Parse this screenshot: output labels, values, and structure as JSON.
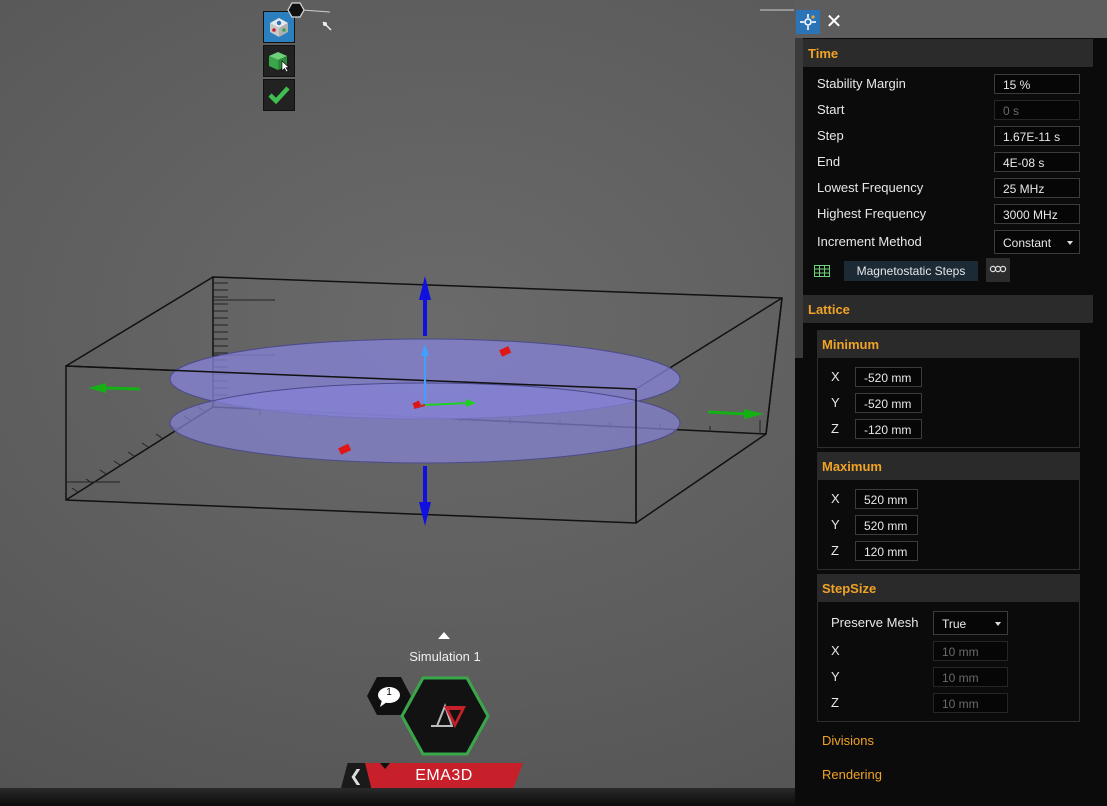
{
  "simulation": {
    "name": "Simulation 1",
    "notification_count": "1"
  },
  "app": {
    "name": "EMA3D"
  },
  "icons": {
    "tool_1": "view-cube-icon",
    "tool_2": "select-object-icon",
    "tool_3": "checkmark-icon",
    "pin": "pin-icon",
    "settings": "settings-icon",
    "close": "close-icon",
    "back": "chevron-left-icon",
    "comment": "comment-icon",
    "logo": "ema3d-logo-icon",
    "table": "table-icon",
    "link": "link-icon"
  },
  "colors": {
    "accent": "#f0a326",
    "brand_red": "#c8202a",
    "selection_blue": "#2b74b8",
    "hex_green": "#3aa64a"
  },
  "time": {
    "title": "Time",
    "stability_margin": {
      "label": "Stability Margin",
      "value": "15 %"
    },
    "start": {
      "label": "Start",
      "value": "0 s"
    },
    "step": {
      "label": "Step",
      "value": "1.67E-11 s"
    },
    "end": {
      "label": "End",
      "value": "4E-08 s"
    },
    "lowest_frequency": {
      "label": "Lowest Frequency",
      "value": "25 MHz"
    },
    "highest_frequency": {
      "label": "Highest Frequency",
      "value": "3000 MHz"
    },
    "increment_method": {
      "label": "Increment Method",
      "value": "Constant"
    },
    "magnetostatic_steps": "Magnetostatic Steps"
  },
  "lattice": {
    "title": "Lattice",
    "minimum": {
      "title": "Minimum",
      "x_label": "X",
      "x": "-520 mm",
      "y_label": "Y",
      "y": "-520 mm",
      "z_label": "Z",
      "z": "-120 mm"
    },
    "maximum": {
      "title": "Maximum",
      "x_label": "X",
      "x": "520 mm",
      "y_label": "Y",
      "y": "520 mm",
      "z_label": "Z",
      "z": "120 mm"
    },
    "stepsize": {
      "title": "StepSize",
      "preserve_mesh": {
        "label": "Preserve Mesh",
        "value": "True"
      },
      "x_label": "X",
      "x": "10 mm",
      "y_label": "Y",
      "y": "10 mm",
      "z_label": "Z",
      "z": "10 mm"
    },
    "divisions": "Divisions",
    "rendering": "Rendering"
  }
}
